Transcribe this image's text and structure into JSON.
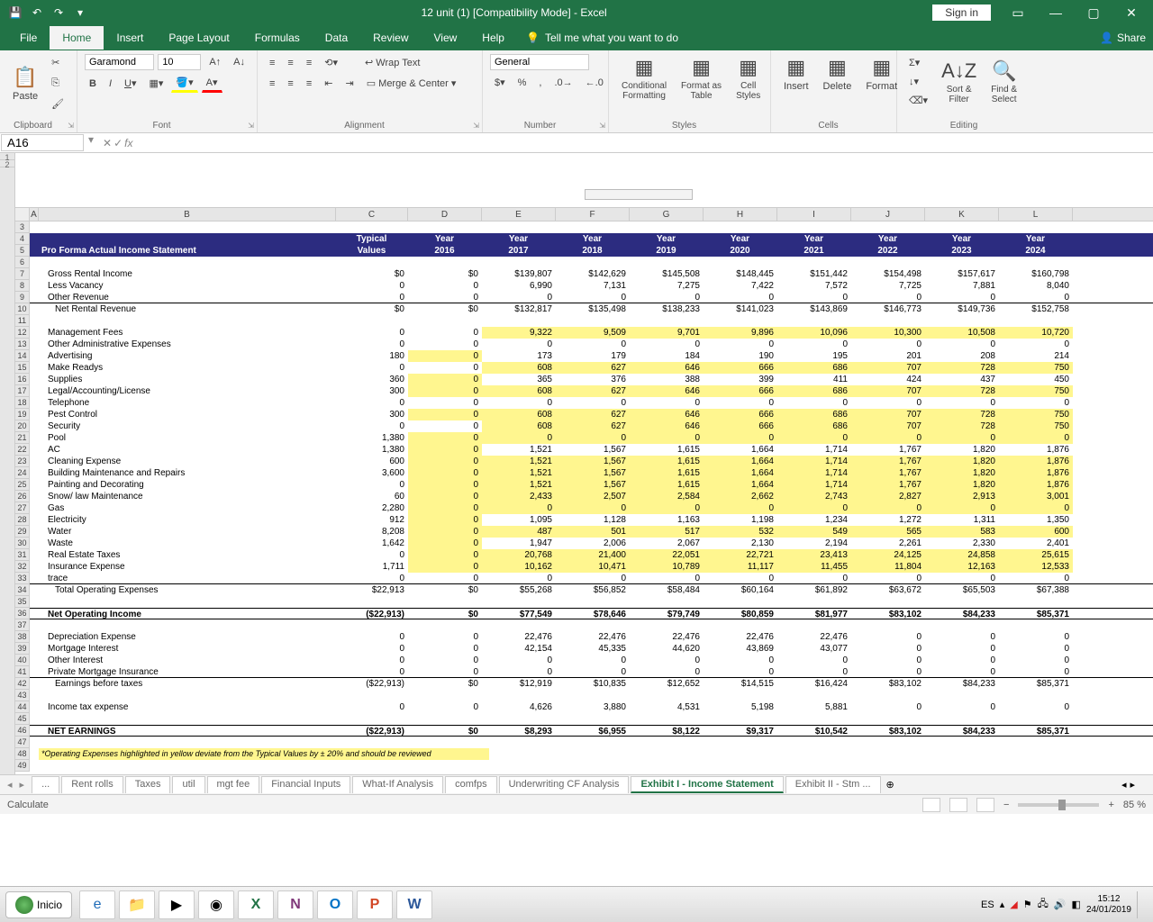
{
  "title": "12 unit (1)  [Compatibility Mode]  -  Excel",
  "signin": "Sign in",
  "tabs": {
    "file": "File",
    "home": "Home",
    "insert": "Insert",
    "page_layout": "Page Layout",
    "formulas": "Formulas",
    "data": "Data",
    "review": "Review",
    "view": "View",
    "help": "Help",
    "tellme": "Tell me what you want to do",
    "share": "Share"
  },
  "ribbon": {
    "clipboard": {
      "paste": "Paste",
      "label": "Clipboard"
    },
    "font": {
      "family": "Garamond",
      "size": "10",
      "label": "Font"
    },
    "alignment": {
      "wrap": "Wrap Text",
      "merge": "Merge & Center",
      "label": "Alignment"
    },
    "number": {
      "format": "General",
      "label": "Number"
    },
    "styles": {
      "cond": "Conditional\nFormatting",
      "fmt_table": "Format as\nTable",
      "cell": "Cell\nStyles",
      "label": "Styles"
    },
    "cells": {
      "insert": "Insert",
      "delete": "Delete",
      "format": "Format",
      "label": "Cells"
    },
    "editing": {
      "sort": "Sort &\nFilter",
      "find": "Find &\nSelect",
      "label": "Editing"
    }
  },
  "namebox": "A16",
  "columns": [
    "A",
    "B",
    "C",
    "D",
    "E",
    "F",
    "G",
    "H",
    "I",
    "J",
    "K",
    "L"
  ],
  "rows_start": 3,
  "rows_end": 49,
  "sheet": {
    "header1": [
      "",
      "",
      "Typical",
      "Year",
      "Year",
      "Year",
      "Year",
      "Year",
      "Year",
      "Year",
      "Year",
      "Year"
    ],
    "header2": [
      "",
      "Pro Forma Actual Income Statement",
      "Values",
      "2016",
      "2017",
      "2018",
      "2019",
      "2020",
      "2021",
      "2022",
      "2023",
      "2024"
    ],
    "rows": [
      {
        "n": 7,
        "label": "Gross Rental Income",
        "indent": 1,
        "vals": [
          "$0",
          "$0",
          "$139,807",
          "$142,629",
          "$145,508",
          "$148,445",
          "$151,442",
          "$154,498",
          "$157,617",
          "$160,798"
        ]
      },
      {
        "n": 8,
        "label": "Less Vacancy",
        "indent": 1,
        "vals": [
          "0",
          "0",
          "6,990",
          "7,131",
          "7,275",
          "7,422",
          "7,572",
          "7,725",
          "7,881",
          "8,040"
        ]
      },
      {
        "n": 9,
        "label": "Other Revenue",
        "indent": 1,
        "vals": [
          "0",
          "0",
          "0",
          "0",
          "0",
          "0",
          "0",
          "0",
          "0",
          "0"
        ],
        "underline": true
      },
      {
        "n": 10,
        "label": "Net Rental Revenue",
        "indent": 2,
        "vals": [
          "$0",
          "$0",
          "$132,817",
          "$135,498",
          "$138,233",
          "$141,023",
          "$143,869",
          "$146,773",
          "$149,736",
          "$152,758"
        ]
      },
      {
        "n": 11,
        "label": "",
        "vals": [
          "",
          "",
          "",
          "",
          "",
          "",
          "",
          "",
          "",
          ""
        ]
      },
      {
        "n": 12,
        "label": "Management Fees",
        "indent": 1,
        "vals": [
          "0",
          "0",
          "9,322",
          "9,509",
          "9,701",
          "9,896",
          "10,096",
          "10,300",
          "10,508",
          "10,720"
        ],
        "hl": [
          4,
          5,
          6,
          7,
          8,
          9,
          10,
          11
        ]
      },
      {
        "n": 13,
        "label": "Other Administrative Expenses",
        "indent": 1,
        "vals": [
          "0",
          "0",
          "0",
          "0",
          "0",
          "0",
          "0",
          "0",
          "0",
          "0"
        ]
      },
      {
        "n": 14,
        "label": "Advertising",
        "indent": 1,
        "vals": [
          "180",
          "0",
          "173",
          "179",
          "184",
          "190",
          "195",
          "201",
          "208",
          "214"
        ],
        "hl": [
          3
        ]
      },
      {
        "n": 15,
        "label": "Make Readys",
        "indent": 1,
        "vals": [
          "0",
          "0",
          "608",
          "627",
          "646",
          "666",
          "686",
          "707",
          "728",
          "750"
        ],
        "hl": [
          4,
          5,
          6,
          7,
          8,
          9,
          10,
          11
        ]
      },
      {
        "n": 16,
        "label": "Supplies",
        "indent": 1,
        "vals": [
          "360",
          "0",
          "365",
          "376",
          "388",
          "399",
          "411",
          "424",
          "437",
          "450"
        ],
        "hl": [
          3
        ]
      },
      {
        "n": 17,
        "label": "Legal/Accounting/License",
        "indent": 1,
        "vals": [
          "300",
          "0",
          "608",
          "627",
          "646",
          "666",
          "686",
          "707",
          "728",
          "750"
        ],
        "hl": [
          3,
          4,
          5,
          6,
          7,
          8,
          9,
          10,
          11
        ]
      },
      {
        "n": 18,
        "label": "Telephone",
        "indent": 1,
        "vals": [
          "0",
          "0",
          "0",
          "0",
          "0",
          "0",
          "0",
          "0",
          "0",
          "0"
        ]
      },
      {
        "n": 19,
        "label": "Pest Control",
        "indent": 1,
        "vals": [
          "300",
          "0",
          "608",
          "627",
          "646",
          "666",
          "686",
          "707",
          "728",
          "750"
        ],
        "hl": [
          3,
          4,
          5,
          6,
          7,
          8,
          9,
          10,
          11
        ]
      },
      {
        "n": 20,
        "label": "Security",
        "indent": 1,
        "vals": [
          "0",
          "0",
          "608",
          "627",
          "646",
          "666",
          "686",
          "707",
          "728",
          "750"
        ],
        "hl": [
          4,
          5,
          6,
          7,
          8,
          9,
          10,
          11
        ]
      },
      {
        "n": 21,
        "label": "Pool",
        "indent": 1,
        "vals": [
          "1,380",
          "0",
          "0",
          "0",
          "0",
          "0",
          "0",
          "0",
          "0",
          "0"
        ],
        "hl": [
          3,
          4,
          5,
          6,
          7,
          8,
          9,
          10,
          11
        ]
      },
      {
        "n": 22,
        "label": "AC",
        "indent": 1,
        "vals": [
          "1,380",
          "0",
          "1,521",
          "1,567",
          "1,615",
          "1,664",
          "1,714",
          "1,767",
          "1,820",
          "1,876"
        ],
        "hl": [
          3
        ]
      },
      {
        "n": 23,
        "label": "Cleaning Expense",
        "indent": 1,
        "vals": [
          "600",
          "0",
          "1,521",
          "1,567",
          "1,615",
          "1,664",
          "1,714",
          "1,767",
          "1,820",
          "1,876"
        ],
        "hl": [
          3,
          4,
          5,
          6,
          7,
          8,
          9,
          10,
          11
        ]
      },
      {
        "n": 24,
        "label": "Building Maintenance and Repairs",
        "indent": 1,
        "vals": [
          "3,600",
          "0",
          "1,521",
          "1,567",
          "1,615",
          "1,664",
          "1,714",
          "1,767",
          "1,820",
          "1,876"
        ],
        "hl": [
          3,
          4,
          5,
          6,
          7,
          8,
          9,
          10,
          11
        ]
      },
      {
        "n": 25,
        "label": "Painting and Decorating",
        "indent": 1,
        "vals": [
          "0",
          "0",
          "1,521",
          "1,567",
          "1,615",
          "1,664",
          "1,714",
          "1,767",
          "1,820",
          "1,876"
        ],
        "hl": [
          3,
          4,
          5,
          6,
          7,
          8,
          9,
          10,
          11
        ]
      },
      {
        "n": 26,
        "label": "Snow/ law  Maintenance",
        "indent": 1,
        "vals": [
          "60",
          "0",
          "2,433",
          "2,507",
          "2,584",
          "2,662",
          "2,743",
          "2,827",
          "2,913",
          "3,001"
        ],
        "hl": [
          3,
          4,
          5,
          6,
          7,
          8,
          9,
          10,
          11
        ]
      },
      {
        "n": 27,
        "label": "Gas",
        "indent": 1,
        "vals": [
          "2,280",
          "0",
          "0",
          "0",
          "0",
          "0",
          "0",
          "0",
          "0",
          "0"
        ],
        "hl": [
          3,
          4,
          5,
          6,
          7,
          8,
          9,
          10,
          11
        ]
      },
      {
        "n": 28,
        "label": "Electricity",
        "indent": 1,
        "vals": [
          "912",
          "0",
          "1,095",
          "1,128",
          "1,163",
          "1,198",
          "1,234",
          "1,272",
          "1,311",
          "1,350"
        ],
        "hl": [
          3
        ]
      },
      {
        "n": 29,
        "label": "Water",
        "indent": 1,
        "vals": [
          "8,208",
          "0",
          "487",
          "501",
          "517",
          "532",
          "549",
          "565",
          "583",
          "600"
        ],
        "hl": [
          3,
          4,
          5,
          6,
          7,
          8,
          9,
          10,
          11
        ]
      },
      {
        "n": 30,
        "label": "Waste",
        "indent": 1,
        "vals": [
          "1,642",
          "0",
          "1,947",
          "2,006",
          "2,067",
          "2,130",
          "2,194",
          "2,261",
          "2,330",
          "2,401"
        ],
        "hl": [
          3
        ]
      },
      {
        "n": 31,
        "label": "Real Estate Taxes",
        "indent": 1,
        "vals": [
          "0",
          "0",
          "20,768",
          "21,400",
          "22,051",
          "22,721",
          "23,413",
          "24,125",
          "24,858",
          "25,615"
        ],
        "hl": [
          3,
          4,
          5,
          6,
          7,
          8,
          9,
          10,
          11
        ]
      },
      {
        "n": 32,
        "label": "Insurance Expense",
        "indent": 1,
        "vals": [
          "1,711",
          "0",
          "10,162",
          "10,471",
          "10,789",
          "11,117",
          "11,455",
          "11,804",
          "12,163",
          "12,533"
        ],
        "hl": [
          3,
          4,
          5,
          6,
          7,
          8,
          9,
          10,
          11
        ]
      },
      {
        "n": 33,
        "label": "trace",
        "indent": 1,
        "vals": [
          "0",
          "0",
          "0",
          "0",
          "0",
          "0",
          "0",
          "0",
          "0",
          "0"
        ],
        "underline": true
      },
      {
        "n": 34,
        "label": "Total Operating Expenses",
        "indent": 2,
        "vals": [
          "$22,913",
          "$0",
          "$55,268",
          "$56,852",
          "$58,484",
          "$60,164",
          "$61,892",
          "$63,672",
          "$65,503",
          "$67,388"
        ]
      },
      {
        "n": 35,
        "label": "",
        "vals": [
          "",
          "",
          "",
          "",
          "",
          "",
          "",
          "",
          "",
          ""
        ]
      },
      {
        "n": 36,
        "label": "Net Operating Income",
        "indent": 1,
        "bold": true,
        "vals": [
          "($22,913)",
          "$0",
          "$77,549",
          "$78,646",
          "$79,749",
          "$80,859",
          "$81,977",
          "$83,102",
          "$84,233",
          "$85,371"
        ],
        "topline": true,
        "underline": true
      },
      {
        "n": 37,
        "label": "",
        "vals": [
          "",
          "",
          "",
          "",
          "",
          "",
          "",
          "",
          "",
          ""
        ]
      },
      {
        "n": 38,
        "label": "Depreciation Expense",
        "indent": 1,
        "vals": [
          "0",
          "0",
          "22,476",
          "22,476",
          "22,476",
          "22,476",
          "22,476",
          "0",
          "0",
          "0"
        ]
      },
      {
        "n": 39,
        "label": "Mortgage Interest",
        "indent": 1,
        "vals": [
          "0",
          "0",
          "42,154",
          "45,335",
          "44,620",
          "43,869",
          "43,077",
          "0",
          "0",
          "0"
        ]
      },
      {
        "n": 40,
        "label": "Other Interest",
        "indent": 1,
        "vals": [
          "0",
          "0",
          "0",
          "0",
          "0",
          "0",
          "0",
          "0",
          "0",
          "0"
        ]
      },
      {
        "n": 41,
        "label": "Private Mortgage Insurance",
        "indent": 1,
        "vals": [
          "0",
          "0",
          "0",
          "0",
          "0",
          "0",
          "0",
          "0",
          "0",
          "0"
        ],
        "underline": true
      },
      {
        "n": 42,
        "label": "Earnings before taxes",
        "indent": 2,
        "vals": [
          "($22,913)",
          "$0",
          "$12,919",
          "$10,835",
          "$12,652",
          "$14,515",
          "$16,424",
          "$83,102",
          "$84,233",
          "$85,371"
        ]
      },
      {
        "n": 43,
        "label": "",
        "vals": [
          "",
          "",
          "",
          "",
          "",
          "",
          "",
          "",
          "",
          ""
        ]
      },
      {
        "n": 44,
        "label": "Income tax expense",
        "indent": 1,
        "vals": [
          "0",
          "0",
          "4,626",
          "3,880",
          "4,531",
          "5,198",
          "5,881",
          "0",
          "0",
          "0"
        ]
      },
      {
        "n": 45,
        "label": "",
        "vals": [
          "",
          "",
          "",
          "",
          "",
          "",
          "",
          "",
          "",
          ""
        ]
      },
      {
        "n": 46,
        "label": "NET EARNINGS",
        "indent": 1,
        "bold": true,
        "vals": [
          "($22,913)",
          "$0",
          "$8,293",
          "$6,955",
          "$8,122",
          "$9,317",
          "$10,542",
          "$83,102",
          "$84,233",
          "$85,371"
        ],
        "topline": true,
        "underline": true
      }
    ],
    "footnote": "*Operating Expenses highlighted in yellow deviate from the Typical Values by ± 20% and should be reviewed"
  },
  "sheet_tabs": [
    "...",
    "Rent rolls",
    "Taxes",
    "util",
    "mgt fee",
    "Financial Inputs",
    "What-If Analysis",
    "comfps",
    "Underwriting CF Analysis",
    "Exhibit I - Income Statement",
    "Exhibit II - Stm ..."
  ],
  "active_tab": "Exhibit I - Income Statement",
  "statusbar": {
    "mode": "Calculate",
    "zoom": "85 %"
  },
  "taskbar": {
    "start": "Inicio",
    "lang": "ES",
    "time": "15:12",
    "date": "24/01/2019"
  }
}
